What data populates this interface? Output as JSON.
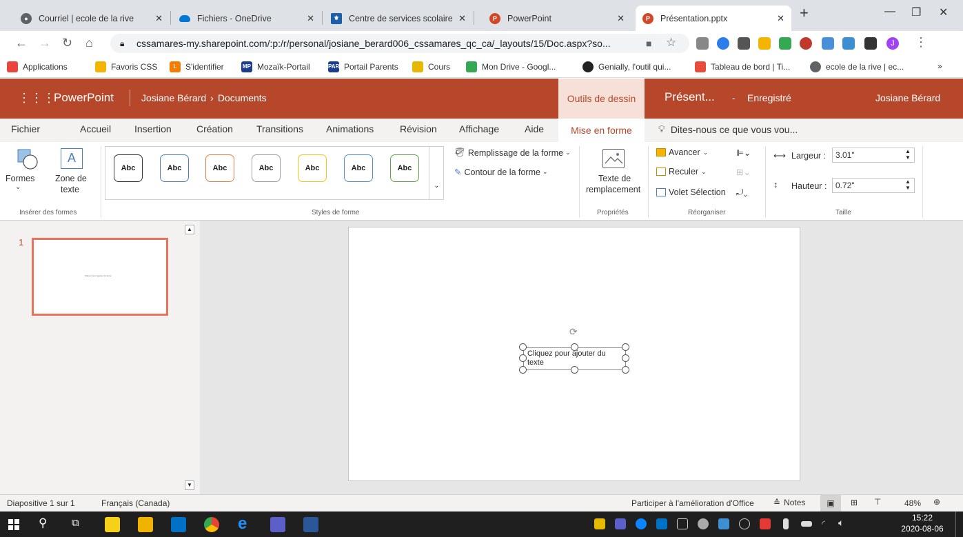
{
  "browser": {
    "tabs": [
      {
        "label": "Courriel | ecole de la rive",
        "icon": "chrome-icon",
        "color": "#5f6368"
      },
      {
        "label": "Fichiers - OneDrive",
        "icon": "onedrive-icon",
        "color": "#0078d4"
      },
      {
        "label": "Centre de services scolaire",
        "icon": "fleur-de-lis-icon",
        "color": "#1d5fa8"
      },
      {
        "label": "PowerPoint",
        "icon": "powerpoint-icon",
        "color": "#d24726"
      },
      {
        "label": "Présentation.pptx",
        "icon": "powerpoint-icon",
        "color": "#d24726"
      }
    ],
    "url": "cssamares-my.sharepoint.com/:p:/r/personal/josiane_berard006_cssamares_qc_ca/_layouts/15/Doc.aspx?so...",
    "bookmarks": [
      {
        "label": "Applications",
        "color": "#e8453c"
      },
      {
        "label": "Favoris CSS",
        "color": "#f4b400"
      },
      {
        "label": "S'identifier",
        "color": "#f57c00"
      },
      {
        "label": "Mozaïk-Portail",
        "color": "#1a3d8f"
      },
      {
        "label": "Portail Parents",
        "color": "#1a3d8f"
      },
      {
        "label": "Cours",
        "color": "#e6b800"
      },
      {
        "label": "Mon Drive - Googl...",
        "color": "#34a853"
      },
      {
        "label": "Genially, l'outil qui...",
        "color": "#222222"
      },
      {
        "label": "Tableau de bord | Ti...",
        "color": "#e74c3c"
      },
      {
        "label": "ecole de la rive | ec...",
        "color": "#5f6368"
      }
    ],
    "bookmark_overflow": "»"
  },
  "ppt": {
    "app": "PowerPoint",
    "breadcrumb_user": "Josiane Bérard",
    "breadcrumb_sep": "›",
    "breadcrumb_folder": "Documents",
    "tool_context": "Outils de dessin",
    "doc_title": "Présent...",
    "save_sep": "-",
    "save_status": "Enregistré",
    "user": "Josiane Bérard",
    "accent": "#b7472a"
  },
  "ribbon_tabs": [
    "Fichier",
    "Accueil",
    "Insertion",
    "Création",
    "Transitions",
    "Animations",
    "Révision",
    "Affichage",
    "Aide"
  ],
  "active_tab": "Mise en forme",
  "tell_me": "Dites-nous ce que vous vou...",
  "ribbon": {
    "formes": "Formes",
    "zone_de_texte_1": "Zone de",
    "zone_de_texte_2": "texte",
    "group_inserer": "Insérer des formes",
    "styles": [
      {
        "label": "Abc",
        "color": "#333333"
      },
      {
        "label": "Abc",
        "color": "#4a7fc1"
      },
      {
        "label": "Abc",
        "color": "#e87f3d"
      },
      {
        "label": "Abc",
        "color": "#9e9e9e"
      },
      {
        "label": "Abc",
        "color": "#f0c419"
      },
      {
        "label": "Abc",
        "color": "#4a90d9"
      },
      {
        "label": "Abc",
        "color": "#5ea344"
      }
    ],
    "remplissage": "Remplissage de la forme",
    "contour": "Contour de la forme",
    "group_styles": "Styles de forme",
    "texte_remplacement_1": "Texte de",
    "texte_remplacement_2": "remplacement",
    "group_proprietes": "Propriétés",
    "avancer": "Avancer",
    "reculer": "Reculer",
    "volet": "Volet Sélection",
    "group_reorganiser": "Réorganiser",
    "largeur_label": "Largeur :",
    "largeur_value": "3.01\"",
    "hauteur_label": "Hauteur :",
    "hauteur_value": "0.72\"",
    "group_taille": "Taille"
  },
  "thumbs": {
    "number": "1",
    "thumb_text": "Cliquez pour ajouter du texte"
  },
  "slide": {
    "textbox": "Cliquez pour ajouter du texte"
  },
  "status": {
    "slide": "Diapositive 1 sur 1",
    "lang": "Français (Canada)",
    "improve": "Participer à l'amélioration d'Office",
    "notes": "Notes",
    "zoom": "48%"
  },
  "taskbar": {
    "time": "15:22",
    "date": "2020-08-06"
  }
}
